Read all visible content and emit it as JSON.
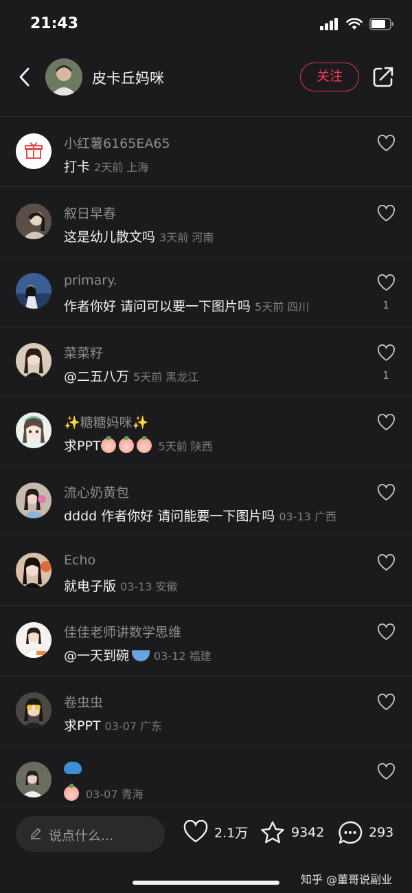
{
  "status_bar": {
    "time": "21:43"
  },
  "header": {
    "author_name": "皮卡丘妈咪",
    "follow_label": "关注"
  },
  "comments": [
    {
      "name": "小红薯6165EA65",
      "text": "打卡",
      "meta": "2天前 上海",
      "likes": ""
    },
    {
      "name": "叙日早春",
      "text": "这是幼儿散文吗",
      "meta": "3天前 河南",
      "likes": ""
    },
    {
      "name": "primary.",
      "text": "作者你好 请问可以要一下图片吗",
      "meta": "5天前 四川",
      "likes": "1"
    },
    {
      "name": "菜菜籽",
      "text": "@二五八万",
      "meta": "5天前 黑龙江",
      "likes": "1"
    },
    {
      "name": "✨糖糖妈咪✨",
      "text": "求PPT",
      "meta": "5天前 陕西",
      "likes": ""
    },
    {
      "name": "流心奶黄包",
      "text": "dddd 作者你好 请问能要一下图片吗",
      "meta": "03-13 广西",
      "likes": ""
    },
    {
      "name": "Echo",
      "text": "就电子版",
      "meta": "03-13 安徽",
      "likes": ""
    },
    {
      "name": "佳佳老师讲数学思维",
      "text": "@一天到碗",
      "meta": "03-12 福建",
      "likes": ""
    },
    {
      "name": "卷虫虫",
      "text": "求PPT",
      "meta": "03-07 广东",
      "likes": ""
    },
    {
      "name": "",
      "text": "",
      "meta": "03-07 青海",
      "likes": ""
    }
  ],
  "bottom_bar": {
    "input_placeholder": "说点什么...",
    "likes": "2.1万",
    "favorites": "9342",
    "comments": "293"
  },
  "watermark": "知乎 @董哥说副业",
  "colors": {
    "accent": "#ff3a56",
    "background": "#1b1b1d"
  }
}
